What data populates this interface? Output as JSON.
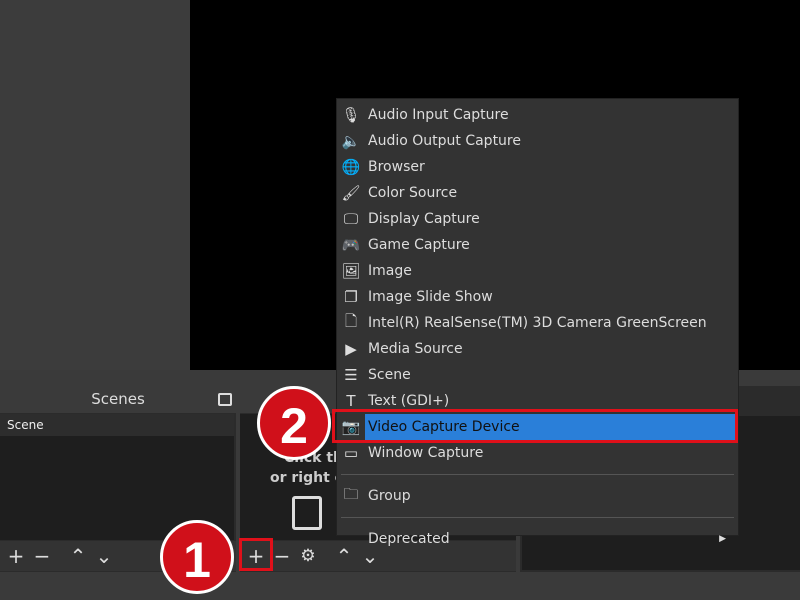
{
  "scenes": {
    "title": "Scenes",
    "items": [
      "Scene"
    ]
  },
  "sources": {
    "hint_lines": [
      "Click the",
      "or right cl"
    ]
  },
  "menu": {
    "items": [
      {
        "label": "Audio Input Capture",
        "icon": "microphone-icon"
      },
      {
        "label": "Audio Output Capture",
        "icon": "speaker-icon"
      },
      {
        "label": "Browser",
        "icon": "globe-icon"
      },
      {
        "label": "Color Source",
        "icon": "brush-icon"
      },
      {
        "label": "Display Capture",
        "icon": "monitor-icon"
      },
      {
        "label": "Game Capture",
        "icon": "gamepad-icon"
      },
      {
        "label": "Image",
        "icon": "image-icon"
      },
      {
        "label": "Image Slide Show",
        "icon": "slideshow-icon"
      },
      {
        "label": "Intel(R) RealSense(TM) 3D Camera GreenScreen",
        "icon": "file-icon"
      },
      {
        "label": "Media Source",
        "icon": "play-icon"
      },
      {
        "label": "Scene",
        "icon": "list-icon"
      },
      {
        "label": "Text (GDI+)",
        "icon": "text-icon"
      },
      {
        "label": "Video Capture Device",
        "icon": "camera-icon",
        "selected": true
      },
      {
        "label": "Window Capture",
        "icon": "window-icon"
      }
    ],
    "group": "Group",
    "deprecated": "Deprecated"
  },
  "annotations": {
    "step1": "1",
    "step2": "2",
    "highlight_color": "#e0101a"
  },
  "selection_color": "#2a7fd9"
}
